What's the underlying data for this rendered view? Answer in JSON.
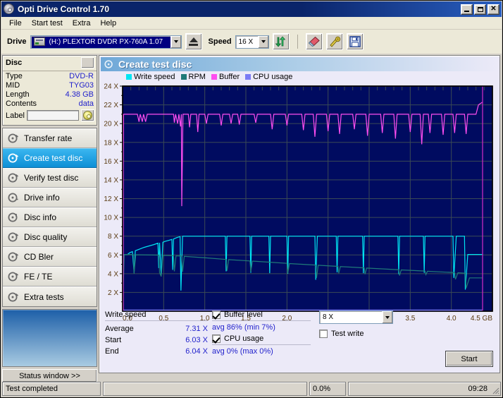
{
  "window": {
    "title": "Opti Drive Control 1.70",
    "icon": "disc-icon",
    "buttons": {
      "minimize": "minimize-icon",
      "maximize": "maximize-icon",
      "close": "close-icon"
    }
  },
  "menu": {
    "items": [
      "File",
      "Start test",
      "Extra",
      "Help"
    ]
  },
  "toolbar": {
    "drive_label": "Drive",
    "drive_value": "(H:)   PLEXTOR DVDR   PX-760A 1.07",
    "eject_icon": "eject-icon",
    "speed_label": "Speed",
    "speed_value": "16 X",
    "refresh_icon": "refresh-icon",
    "erase_icon": "eraser-icon",
    "tools_icon": "tools-icon",
    "save_icon": "save-icon"
  },
  "disc": {
    "title": "Disc",
    "rows": [
      {
        "key": "Type",
        "value": "DVD-R"
      },
      {
        "key": "MID",
        "value": "TYG03"
      },
      {
        "key": "Length",
        "value": "4.38 GB"
      },
      {
        "key": "Contents",
        "value": "data"
      }
    ],
    "label_key": "Label",
    "label_value": "",
    "label_button_icon": "disc-icon"
  },
  "sidebar": {
    "items": [
      {
        "label": "Transfer rate",
        "icon": "disc-test-icon",
        "active": false
      },
      {
        "label": "Create test disc",
        "icon": "disc-write-icon",
        "active": true
      },
      {
        "label": "Verify test disc",
        "icon": "disc-verify-icon",
        "active": false
      },
      {
        "label": "Drive info",
        "icon": "disc-info-icon",
        "active": false
      },
      {
        "label": "Disc info",
        "icon": "disc-info-icon",
        "active": false
      },
      {
        "label": "Disc quality",
        "icon": "disc-quality-icon",
        "active": false
      },
      {
        "label": "CD Bler",
        "icon": "disc-bler-icon",
        "active": false
      },
      {
        "label": "FE / TE",
        "icon": "disc-fete-icon",
        "active": false
      },
      {
        "label": "Extra tests",
        "icon": "disc-extra-icon",
        "active": false
      }
    ],
    "status_window_button": "Status window >>"
  },
  "panel": {
    "title": "Create test disc",
    "icon": "disc-write-icon"
  },
  "results": {
    "write_speed_header": "Write speed",
    "rows": [
      {
        "key": "Average",
        "value": "7.31 X"
      },
      {
        "key": "Start",
        "value": "6.03 X"
      },
      {
        "key": "End",
        "value": "6.04 X"
      }
    ],
    "buffer_level_label": "Buffer level",
    "buffer_level_checked": true,
    "buffer_note": "avg 86% (min 7%)",
    "cpu_usage_label": "CPU usage",
    "cpu_usage_checked": true,
    "cpu_note": "avg 0% (max 0%)",
    "write_speed_select": "8 X",
    "test_write_label": "Test write",
    "test_write_checked": false,
    "start_button": "Start"
  },
  "statusbar": {
    "message": "Test completed",
    "progress_percent": "0.0%",
    "progress_value": 0,
    "time": "09:28"
  },
  "colors": {
    "write_speed": "#00e5f2",
    "rpm": "#1f7a78",
    "buffer": "#ff4df0",
    "cpu_usage": "#7b7bf5",
    "plot_bg": "#000b60",
    "grid": "#3a4a55",
    "accent": "#0a246a",
    "value_text": "#2222cc"
  },
  "chart_data": {
    "type": "line",
    "title": "Create test disc",
    "xlabel": "GB",
    "ylabel": "X",
    "xlim": [
      0.0,
      4.5
    ],
    "ylim": [
      0,
      24
    ],
    "xticks": [
      0.0,
      0.5,
      1.0,
      1.5,
      2.0,
      2.5,
      3.0,
      3.5,
      4.0,
      4.5
    ],
    "xticklabels": [
      "0.0",
      "0.5",
      "1.0",
      "1.5",
      "2.0",
      "2.5",
      "3.0",
      "3.5",
      "4.0",
      "4.5 GB"
    ],
    "yticks": [
      2,
      4,
      6,
      8,
      10,
      12,
      14,
      16,
      18,
      20,
      22,
      24
    ],
    "yticklabels": [
      "2 X",
      "4 X",
      "6 X",
      "8 X",
      "10 X",
      "12 X",
      "14 X",
      "16 X",
      "18 X",
      "20 X",
      "22 X",
      "24 X"
    ],
    "grid": true,
    "legend_position": "top-left",
    "legend": [
      "Write speed",
      "RPM",
      "Buffer",
      "CPU usage"
    ],
    "end_marker_x": 4.38,
    "series": [
      {
        "name": "Write speed",
        "color": "#00e5f2",
        "unit": "X",
        "points": [
          [
            0.0,
            0.0
          ],
          [
            0.01,
            6.05
          ],
          [
            0.06,
            6.05
          ],
          [
            0.09,
            6.25
          ],
          [
            0.12,
            6.35
          ],
          [
            0.14,
            4.1
          ],
          [
            0.155,
            6.45
          ],
          [
            0.2,
            6.6
          ],
          [
            0.26,
            6.8
          ],
          [
            0.32,
            6.95
          ],
          [
            0.38,
            7.1
          ],
          [
            0.43,
            7.25
          ],
          [
            0.44,
            4.6
          ],
          [
            0.45,
            7.3
          ],
          [
            0.47,
            3.8
          ],
          [
            0.49,
            7.35
          ],
          [
            0.52,
            7.45
          ],
          [
            0.56,
            7.55
          ],
          [
            0.6,
            7.65
          ],
          [
            0.61,
            4.4
          ],
          [
            0.62,
            7.7
          ],
          [
            0.66,
            7.85
          ],
          [
            0.7,
            7.95
          ],
          [
            0.71,
            2.2
          ],
          [
            0.73,
            8.0
          ],
          [
            1.0,
            8.0
          ],
          [
            1.25,
            8.0
          ],
          [
            1.26,
            4.25
          ],
          [
            1.27,
            8.0
          ],
          [
            1.55,
            8.0
          ],
          [
            1.56,
            4.1
          ],
          [
            1.57,
            8.0
          ],
          [
            1.78,
            8.0
          ],
          [
            1.79,
            4.05
          ],
          [
            1.8,
            8.0
          ],
          [
            2.0,
            8.0
          ],
          [
            2.01,
            4.0
          ],
          [
            2.02,
            8.0
          ],
          [
            2.34,
            8.0
          ],
          [
            2.35,
            3.35
          ],
          [
            2.37,
            8.0
          ],
          [
            2.6,
            8.0
          ],
          [
            2.61,
            4.15
          ],
          [
            2.62,
            8.0
          ],
          [
            2.92,
            8.0
          ],
          [
            2.93,
            4.05
          ],
          [
            2.94,
            8.0
          ],
          [
            3.35,
            8.0
          ],
          [
            3.36,
            3.95
          ],
          [
            3.37,
            8.0
          ],
          [
            3.66,
            8.0
          ],
          [
            3.67,
            4.1
          ],
          [
            3.68,
            8.0
          ],
          [
            4.02,
            8.0
          ],
          [
            4.03,
            3.55
          ],
          [
            4.06,
            8.0
          ],
          [
            4.16,
            8.0
          ],
          [
            4.17,
            2.3
          ],
          [
            4.2,
            6.05
          ],
          [
            4.38,
            6.05
          ]
        ]
      },
      {
        "name": "RPM",
        "color": "#1f7a78",
        "unit": "X",
        "points": [
          [
            0.0,
            0.0
          ],
          [
            0.02,
            6.05
          ],
          [
            0.13,
            6.05
          ],
          [
            0.14,
            4.0
          ],
          [
            0.16,
            6.02
          ],
          [
            0.44,
            5.98
          ],
          [
            0.45,
            4.1
          ],
          [
            0.47,
            3.7
          ],
          [
            0.49,
            5.95
          ],
          [
            0.62,
            5.92
          ],
          [
            0.63,
            4.25
          ],
          [
            0.65,
            5.9
          ],
          [
            0.72,
            5.88
          ],
          [
            0.73,
            4.2
          ],
          [
            0.75,
            5.85
          ],
          [
            1.0,
            5.7
          ],
          [
            1.26,
            5.52
          ],
          [
            1.27,
            4.3
          ],
          [
            1.29,
            5.5
          ],
          [
            1.55,
            5.36
          ],
          [
            1.56,
            4.2
          ],
          [
            1.58,
            5.34
          ],
          [
            1.8,
            5.22
          ],
          [
            2.0,
            5.1
          ],
          [
            2.01,
            4.05
          ],
          [
            2.03,
            5.08
          ],
          [
            2.35,
            4.92
          ],
          [
            2.36,
            3.55
          ],
          [
            2.38,
            4.9
          ],
          [
            2.62,
            4.78
          ],
          [
            2.63,
            4.05
          ],
          [
            2.65,
            4.76
          ],
          [
            2.94,
            4.62
          ],
          [
            2.95,
            3.95
          ],
          [
            2.97,
            4.6
          ],
          [
            3.36,
            4.42
          ],
          [
            3.37,
            3.8
          ],
          [
            3.39,
            4.4
          ],
          [
            3.68,
            4.28
          ],
          [
            3.69,
            3.9
          ],
          [
            3.71,
            4.26
          ],
          [
            4.04,
            4.12
          ],
          [
            4.05,
            3.4
          ],
          [
            4.08,
            4.1
          ],
          [
            4.17,
            4.05
          ],
          [
            4.18,
            2.45
          ],
          [
            4.22,
            3.55
          ],
          [
            4.38,
            3.55
          ]
        ]
      },
      {
        "name": "Buffer",
        "color": "#ff4df0",
        "unit": "X",
        "scale_note": "buffer level percentage mapped onto the X-speed axis; plateau ≈ 21 X ≈ 88%",
        "points": [
          [
            0.0,
            0.0
          ],
          [
            0.005,
            11.0
          ],
          [
            0.012,
            21.0
          ],
          [
            0.18,
            21.0
          ],
          [
            0.2,
            20.2
          ],
          [
            0.215,
            21.0
          ],
          [
            0.24,
            20.2
          ],
          [
            0.255,
            21.0
          ],
          [
            0.28,
            20.2
          ],
          [
            0.3,
            21.0
          ],
          [
            0.62,
            21.0
          ],
          [
            0.63,
            20.1
          ],
          [
            0.645,
            21.0
          ],
          [
            0.67,
            20.0
          ],
          [
            0.685,
            21.0
          ],
          [
            0.705,
            19.7
          ],
          [
            0.715,
            21.0
          ],
          [
            0.72,
            11.2
          ],
          [
            0.735,
            21.0
          ],
          [
            0.8,
            21.0
          ],
          [
            0.815,
            19.6
          ],
          [
            0.83,
            21.0
          ],
          [
            0.9,
            21.0
          ],
          [
            0.915,
            19.1
          ],
          [
            0.93,
            21.0
          ],
          [
            1.0,
            21.0
          ],
          [
            1.02,
            20.0
          ],
          [
            1.04,
            21.0
          ],
          [
            1.18,
            21.0
          ],
          [
            1.2,
            19.8
          ],
          [
            1.22,
            21.0
          ],
          [
            1.3,
            21.0
          ],
          [
            1.32,
            20.0
          ],
          [
            1.34,
            21.0
          ],
          [
            1.4,
            21.0
          ],
          [
            1.42,
            19.9
          ],
          [
            1.44,
            21.0
          ],
          [
            1.6,
            21.0
          ],
          [
            1.62,
            20.1
          ],
          [
            1.64,
            21.0
          ],
          [
            1.8,
            21.0
          ],
          [
            1.82,
            19.4
          ],
          [
            1.84,
            21.0
          ],
          [
            1.98,
            21.0
          ],
          [
            2.0,
            19.8
          ],
          [
            2.02,
            21.0
          ],
          [
            2.18,
            21.0
          ],
          [
            2.2,
            19.3
          ],
          [
            2.22,
            21.0
          ],
          [
            2.32,
            21.0
          ],
          [
            2.34,
            18.6
          ],
          [
            2.36,
            21.0
          ],
          [
            2.48,
            21.0
          ],
          [
            2.5,
            19.2
          ],
          [
            2.52,
            21.0
          ],
          [
            2.62,
            21.0
          ],
          [
            2.64,
            18.9
          ],
          [
            2.66,
            21.0
          ],
          [
            2.8,
            21.0
          ],
          [
            2.82,
            19.4
          ],
          [
            2.84,
            21.0
          ],
          [
            2.96,
            21.0
          ],
          [
            2.98,
            18.7
          ],
          [
            3.0,
            21.0
          ],
          [
            3.14,
            21.0
          ],
          [
            3.16,
            19.0
          ],
          [
            3.18,
            21.0
          ],
          [
            3.3,
            21.0
          ],
          [
            3.32,
            18.4
          ],
          [
            3.34,
            21.0
          ],
          [
            3.48,
            21.0
          ],
          [
            3.5,
            19.1
          ],
          [
            3.52,
            21.0
          ],
          [
            3.62,
            21.0
          ],
          [
            3.64,
            17.8
          ],
          [
            3.66,
            21.0
          ],
          [
            3.72,
            21.0
          ],
          [
            3.74,
            19.0
          ],
          [
            3.76,
            21.0
          ],
          [
            3.88,
            21.0
          ],
          [
            3.9,
            18.8
          ],
          [
            3.92,
            21.0
          ],
          [
            4.02,
            21.0
          ],
          [
            4.04,
            19.0
          ],
          [
            4.06,
            21.0
          ],
          [
            4.16,
            21.0
          ],
          [
            4.18,
            18.9
          ],
          [
            4.2,
            21.0
          ],
          [
            4.3,
            21.0
          ],
          [
            4.33,
            22.0
          ],
          [
            4.38,
            22.3
          ]
        ]
      },
      {
        "name": "CPU usage",
        "color": "#7b7bf5",
        "unit": "%",
        "points": [
          [
            0.0,
            0.0
          ],
          [
            4.38,
            0.0
          ]
        ]
      }
    ]
  }
}
